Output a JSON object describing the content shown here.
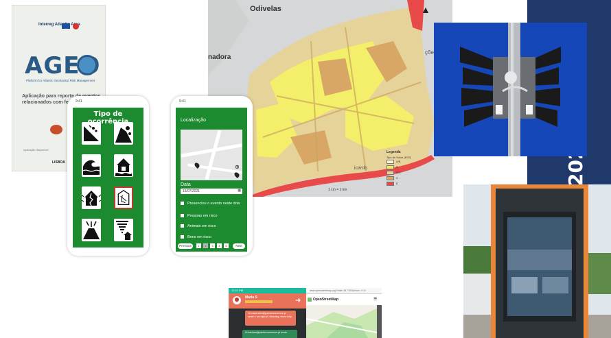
{
  "poster": {
    "brand_small": "Interreg Atlantic Area",
    "title": "AGEO",
    "subtitle": "Platform for Atlantic Geohazard Risk Management",
    "description": "Aplicação para reporte de eventos relacionados com fenó...",
    "availability": "Aplicação disponível",
    "city": "LISBOA"
  },
  "phone1": {
    "status_time": "9:41",
    "title": "Tipo de ocorrência",
    "tiles": [
      {
        "icon": "landslide-icon"
      },
      {
        "icon": "rockfall-icon"
      },
      {
        "icon": "tsunami-icon"
      },
      {
        "icon": "flood-house-icon"
      },
      {
        "icon": "earthquake-house-icon"
      },
      {
        "icon": "building-collapse-icon"
      },
      {
        "icon": "volcano-icon"
      },
      {
        "icon": "tornado-icon"
      }
    ]
  },
  "phone2": {
    "status_time": "9:41",
    "location_label": "Localização",
    "date_label": "Data",
    "date_value": "15/07/2021",
    "checks": [
      "Presenciou o evento neste dois",
      "Pessoas em risco",
      "Animais em risco",
      "Bens em risco"
    ],
    "prev_label": "Previous",
    "next_label": "Next",
    "pages": [
      "1",
      "2",
      "3",
      "4",
      "5"
    ],
    "current_page": "2"
  },
  "map": {
    "place_north": "Odivelas",
    "place_west": "nadora",
    "place_east": "ções",
    "place_south": "icardo",
    "legend_title": "Legenda",
    "legend_subtitle": "Tipo de Solos (EC8)",
    "legend_items": [
      {
        "label": "A/B",
        "color": "#fbf6d0"
      },
      {
        "label": "B",
        "color": "#f3ef6a"
      },
      {
        "label": "B/C",
        "color": "#e6d39a"
      },
      {
        "label": "C",
        "color": "#d8a665"
      },
      {
        "label": "D",
        "color": "#e84a4a"
      }
    ],
    "scale": "1 cm = 1 km"
  },
  "navy_band": {
    "year_fragment": "202"
  },
  "chat": {
    "status": "12:07 PM",
    "name": "Maria S",
    "msg1": "Hi maria.silva@parishcommerce.pt wrote: I am injured. Bleeding. Need help.",
    "msg2": "Hi barbara@parishcommerce.pt wrote:"
  },
  "osm": {
    "url": "www.openstreetmap.org/?mlat=38.7163&mlon=-9.14",
    "brand": "OpenStreetMap",
    "menu": "☰"
  },
  "colors": {
    "navy": "#1f3a6a",
    "app_green": "#1c8a2e",
    "siren_sky": "#1547b8",
    "kiosk_frame": "#e8873a"
  }
}
